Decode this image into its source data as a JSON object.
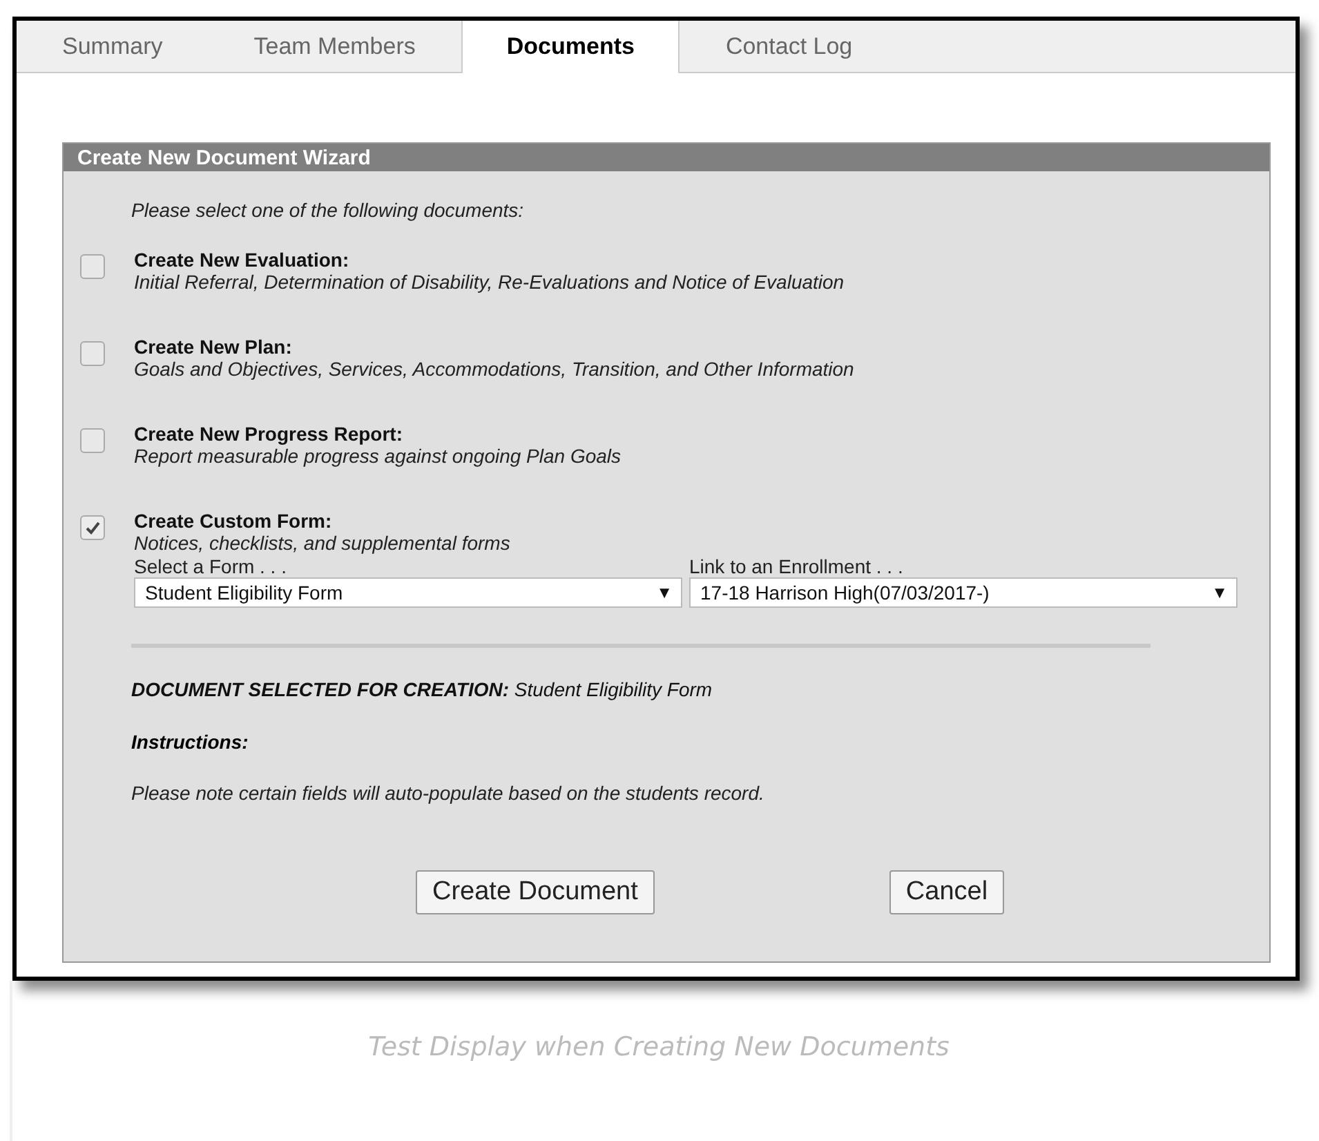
{
  "tabs": [
    {
      "label": "Summary",
      "selected": false
    },
    {
      "label": "Team Members",
      "selected": false
    },
    {
      "label": "Documents",
      "selected": true
    },
    {
      "label": "Contact Log",
      "selected": false
    }
  ],
  "wizard": {
    "title": "Create New Document Wizard",
    "prompt": "Please select one of the following documents:",
    "options": [
      {
        "title": "Create New Evaluation:",
        "description": "Initial Referral, Determination of Disability, Re-Evaluations and Notice of Evaluation",
        "checked": false
      },
      {
        "title": "Create New Plan:",
        "description": "Goals and Objectives, Services, Accommodations, Transition, and Other Information",
        "checked": false
      },
      {
        "title": "Create New Progress Report:",
        "description": "Report measurable progress against ongoing Plan Goals",
        "checked": false
      },
      {
        "title": "Create Custom Form:",
        "description": "Notices, checklists, and supplemental forms",
        "checked": true
      }
    ],
    "selects": [
      {
        "label": "Select a Form . . .",
        "value": "Student Eligibility Form",
        "arrow": "▼"
      },
      {
        "label": "Link to an Enrollment . . .",
        "value": "17-18 Harrison High(07/03/2017-)",
        "arrow": "▼"
      }
    ],
    "selected_document": "**DOCUMENT SELECTED FOR CREATION:** Student Eligibility Form",
    "instructions_label": "Instructions:",
    "instructions": "Please note certain fields will auto-populate based on the students record.",
    "buttons": [
      "Create Document",
      "Cancel"
    ]
  },
  "caption": "Test Display when Creating New Documents"
}
